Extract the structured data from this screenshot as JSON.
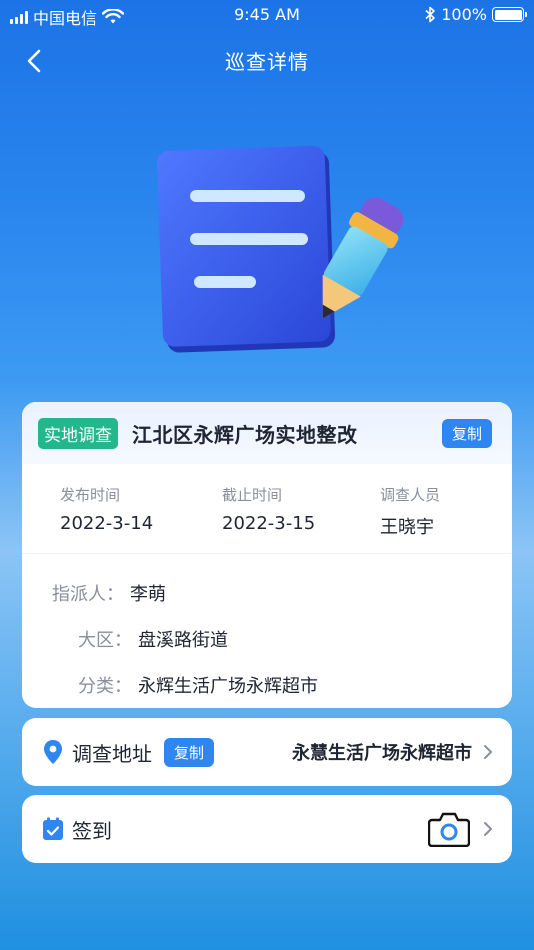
{
  "status_bar": {
    "carrier": "中国电信",
    "time": "9:45 AM",
    "battery": "100%"
  },
  "nav": {
    "title": "巡查详情"
  },
  "task": {
    "tag": "实地调查",
    "name": "江北区永辉广场实地整改",
    "copy_label": "复制",
    "meta": [
      {
        "label": "发布时间",
        "value": "2022-3-14"
      },
      {
        "label": "截止时间",
        "value": "2022-3-15"
      },
      {
        "label": "调查人员",
        "value": "王晓宇"
      }
    ],
    "rows": [
      {
        "key": "指派人：",
        "value": "李萌"
      },
      {
        "key": "大区：",
        "value": "盘溪路街道"
      },
      {
        "key": "分类：",
        "value": "永辉生活广场永辉超市"
      }
    ]
  },
  "address": {
    "label": "调查地址",
    "copy_label": "复制",
    "value": "永慧生活广场永辉超市"
  },
  "signin": {
    "label": "签到"
  },
  "colors": {
    "accent": "#2f86f0",
    "tag_green": "#22b88c"
  }
}
